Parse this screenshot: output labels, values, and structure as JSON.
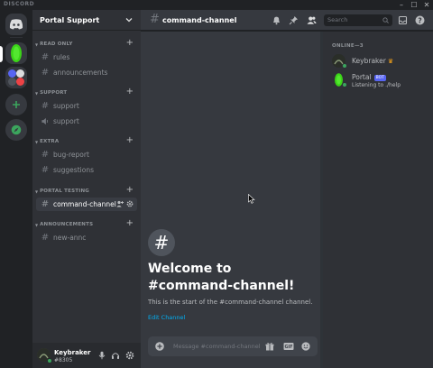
{
  "window": {
    "brand": "DISCORD",
    "minimize": "–",
    "maximize": "☐",
    "close": "✕"
  },
  "server": {
    "name": "Portal Support"
  },
  "sidebar": {
    "categories": [
      {
        "label": "READ ONLY",
        "channels": [
          {
            "label": "rules",
            "type": "text"
          },
          {
            "label": "announcements",
            "type": "text"
          }
        ]
      },
      {
        "label": "SUPPORT",
        "channels": [
          {
            "label": "support",
            "type": "text"
          },
          {
            "label": "support",
            "type": "voice"
          }
        ]
      },
      {
        "label": "EXTRA",
        "channels": [
          {
            "label": "bug-report",
            "type": "text"
          },
          {
            "label": "suggestions",
            "type": "text"
          }
        ]
      },
      {
        "label": "PORTAL TESTING",
        "channels": [
          {
            "label": "command-channel",
            "type": "text",
            "active": true
          }
        ]
      },
      {
        "label": "ANNOUNCEMENTS",
        "channels": [
          {
            "label": "new-annc",
            "type": "text"
          }
        ]
      }
    ]
  },
  "user": {
    "name": "Keybraker",
    "tag": "#8305"
  },
  "header": {
    "channel": "command-channel"
  },
  "search": {
    "placeholder": "Search"
  },
  "welcome": {
    "title": "Welcome to #command-channel!",
    "subtitle": "This is the start of the #command-channel channel.",
    "edit_link": "Edit Channel"
  },
  "composer": {
    "placeholder": "Message #command-channel",
    "gif": "GIF"
  },
  "members": {
    "category": "ONLINE—3",
    "list": [
      {
        "name": "Keybraker",
        "owner": true,
        "color": "#2a2e28"
      },
      {
        "name": "Portal",
        "bot_badge": "BOT",
        "activity": "Listening to ./help",
        "color": "#3bd418"
      }
    ]
  },
  "colors": {
    "accent": "#5865f2",
    "online": "#3ba55d",
    "link": "#00b0f4",
    "portal_green": "#3bd418"
  }
}
